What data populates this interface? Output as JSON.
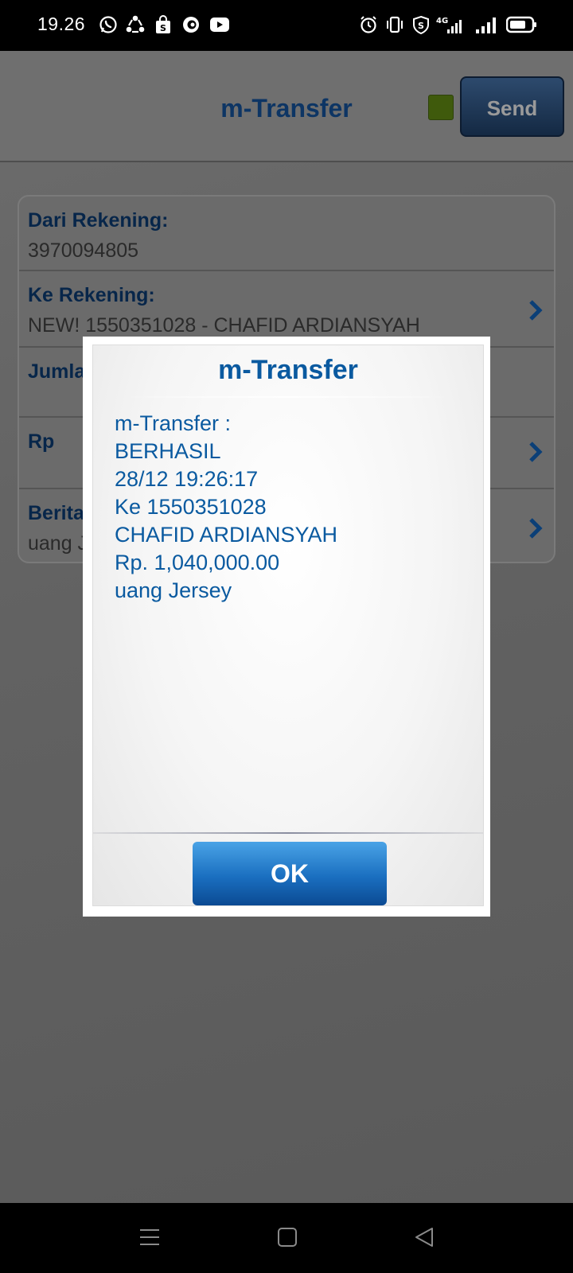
{
  "status_bar": {
    "time": "19.26",
    "left_icons": [
      "whatsapp-icon",
      "share-icon",
      "shop-icon",
      "browser-icon",
      "youtube-icon"
    ],
    "right_icons": [
      "alarm-icon",
      "vibrate-icon",
      "shield-icon",
      "network-4g-icon",
      "signal-icon",
      "battery-icon"
    ],
    "network_label": "4G"
  },
  "header": {
    "title": "m-Transfer",
    "send_label": "Send",
    "indicator_color": "#3f5a0c"
  },
  "form": {
    "rows": [
      {
        "label": "Dari Rekening:",
        "value": "3970094805",
        "has_chevron": false
      },
      {
        "label": "Ke Rekening:",
        "value": "NEW! 1550351028 - CHAFID ARDIANSYAH",
        "has_chevron": true
      },
      {
        "label": "Jumla",
        "value": "",
        "has_chevron": false
      },
      {
        "label": "Rp",
        "value": "",
        "has_chevron": true
      },
      {
        "label": "Berita",
        "value": "uang J",
        "has_chevron": true
      }
    ]
  },
  "dialog": {
    "title": "m-Transfer",
    "lines": [
      "m-Transfer :",
      "BERHASIL",
      "28/12 19:26:17",
      "Ke 1550351028",
      "CHAFID ARDIANSYAH",
      "Rp. 1,040,000.00",
      "uang Jersey"
    ],
    "ok_label": "OK"
  },
  "nav_bar": {
    "icons": [
      "menu-icon",
      "home-icon",
      "back-icon"
    ]
  },
  "colors": {
    "accent": "#0a5aa0",
    "label": "#07264a",
    "ok_button": "#1a6fc0"
  }
}
